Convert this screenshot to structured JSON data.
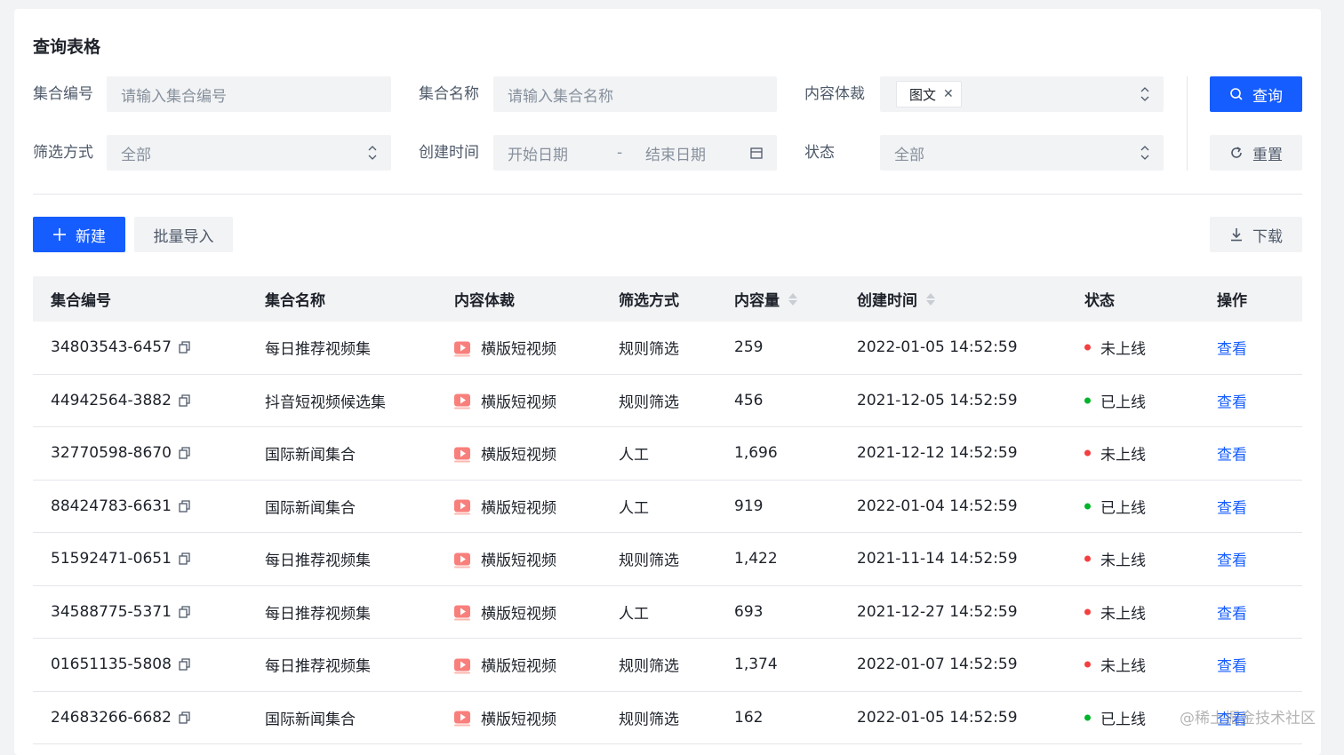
{
  "page": {
    "title": "查询表格"
  },
  "filters": {
    "set_id": {
      "label": "集合编号",
      "placeholder": "请输入集合编号"
    },
    "set_name": {
      "label": "集合名称",
      "placeholder": "请输入集合名称"
    },
    "content_type": {
      "label": "内容体裁",
      "tag": "图文"
    },
    "filter_mode": {
      "label": "筛选方式",
      "value": "全部"
    },
    "created_time": {
      "label": "创建时间",
      "start_placeholder": "开始日期",
      "separator": "-",
      "end_placeholder": "结束日期"
    },
    "status": {
      "label": "状态",
      "value": "全部"
    }
  },
  "actions": {
    "search_label": "查询",
    "reset_label": "重置",
    "new_label": "新建",
    "import_label": "批量导入",
    "download_label": "下载"
  },
  "table": {
    "columns": [
      "集合编号",
      "集合名称",
      "内容体裁",
      "筛选方式",
      "内容量",
      "创建时间",
      "状态",
      "操作"
    ],
    "rows": [
      {
        "id": "34803543-6457",
        "name": "每日推荐视频集",
        "type": "横版短视频",
        "mode": "规则筛选",
        "count": "259",
        "time": "2022-01-05 14:52:59",
        "status": "未上线",
        "online": false,
        "action": "查看"
      },
      {
        "id": "44942564-3882",
        "name": "抖音短视频候选集",
        "type": "横版短视频",
        "mode": "规则筛选",
        "count": "456",
        "time": "2021-12-05 14:52:59",
        "status": "已上线",
        "online": true,
        "action": "查看"
      },
      {
        "id": "32770598-8670",
        "name": "国际新闻集合",
        "type": "横版短视频",
        "mode": "人工",
        "count": "1,696",
        "time": "2021-12-12 14:52:59",
        "status": "未上线",
        "online": false,
        "action": "查看"
      },
      {
        "id": "88424783-6631",
        "name": "国际新闻集合",
        "type": "横版短视频",
        "mode": "人工",
        "count": "919",
        "time": "2022-01-04 14:52:59",
        "status": "已上线",
        "online": true,
        "action": "查看"
      },
      {
        "id": "51592471-0651",
        "name": "每日推荐视频集",
        "type": "横版短视频",
        "mode": "规则筛选",
        "count": "1,422",
        "time": "2021-11-14 14:52:59",
        "status": "未上线",
        "online": false,
        "action": "查看"
      },
      {
        "id": "34588775-5371",
        "name": "每日推荐视频集",
        "type": "横版短视频",
        "mode": "人工",
        "count": "693",
        "time": "2021-12-27 14:52:59",
        "status": "未上线",
        "online": false,
        "action": "查看"
      },
      {
        "id": "01651135-5808",
        "name": "每日推荐视频集",
        "type": "横版短视频",
        "mode": "规则筛选",
        "count": "1,374",
        "time": "2022-01-07 14:52:59",
        "status": "未上线",
        "online": false,
        "action": "查看"
      },
      {
        "id": "24683266-6682",
        "name": "国际新闻集合",
        "type": "横版短视频",
        "mode": "规则筛选",
        "count": "162",
        "time": "2022-01-05 14:52:59",
        "status": "已上线",
        "online": true,
        "action": "查看"
      }
    ]
  },
  "colors": {
    "primary": "#165dff",
    "online": "#00b42a",
    "offline": "#f53f3f"
  },
  "watermark": "@稀土掘金技术社区"
}
